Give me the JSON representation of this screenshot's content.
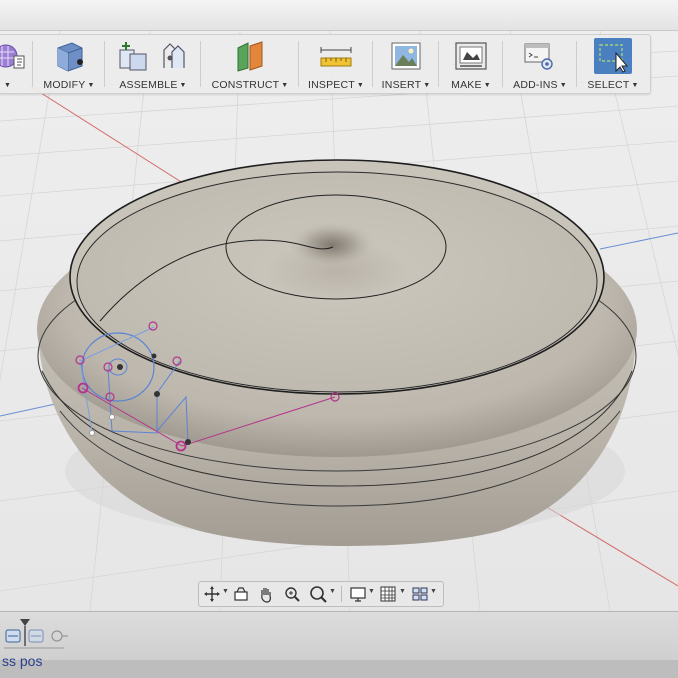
{
  "toolbar": {
    "groups": [
      {
        "name": "create",
        "label": "",
        "icon": "create-sheetmetal-icon"
      },
      {
        "name": "modify",
        "label": "MODIFY",
        "icon": "modify-box-icon"
      },
      {
        "name": "assemble",
        "label": "ASSEMBLE",
        "icon": "assemble-component-icon"
      },
      {
        "name": "construct",
        "label": "CONSTRUCT",
        "icon": "construct-plane-icon"
      },
      {
        "name": "inspect",
        "label": "INSPECT",
        "icon": "inspect-ruler-icon"
      },
      {
        "name": "insert",
        "label": "INSERT",
        "icon": "insert-image-icon"
      },
      {
        "name": "make",
        "label": "MAKE",
        "icon": "make-printer-icon"
      },
      {
        "name": "addins",
        "label": "ADD-INS",
        "icon": "addins-script-icon"
      },
      {
        "name": "select",
        "label": "SELECT",
        "icon": "select-cursor-icon",
        "active": true
      }
    ]
  },
  "navbar": {
    "items": [
      "orbit-icon",
      "look-at-icon",
      "pan-hand-icon",
      "zoom-window-icon",
      "zoom-icon",
      "display-settings-icon",
      "grid-icon",
      "viewports-icon"
    ]
  },
  "timeline": {
    "items": [
      "playhead-marker-icon",
      "component-feature-icon",
      "component-feature-icon",
      "joint-feature-icon"
    ]
  },
  "status": {
    "text": "ss pos"
  },
  "colors": {
    "body": "#c3bdb3",
    "grid": "#d4d4d4",
    "sketch_blue": "#5a84d6",
    "sketch_magenta": "#b5338c",
    "axis_red": "#d46a6a",
    "axis_blue": "#6a8fd4",
    "select_active": "#4a7fc0"
  }
}
